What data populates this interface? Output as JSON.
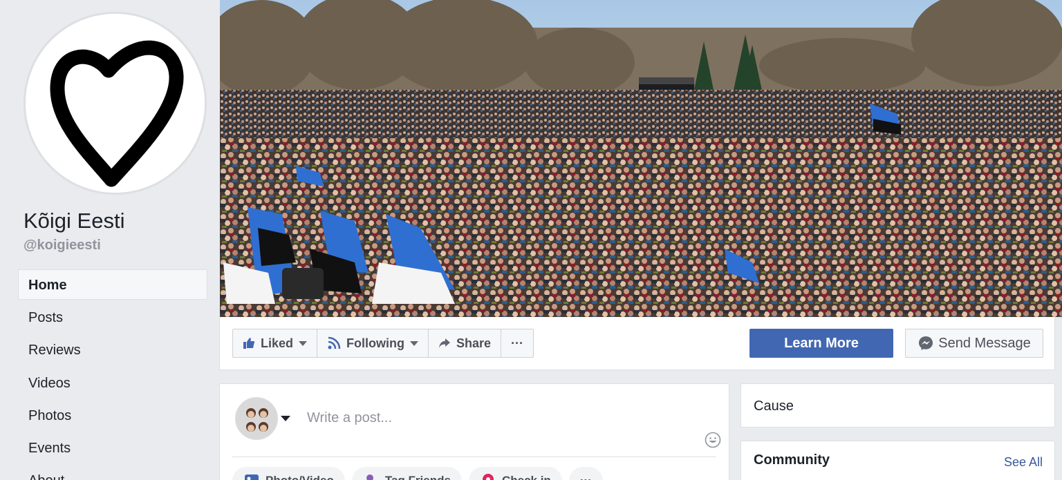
{
  "page": {
    "name": "Kõigi Eesti",
    "handle": "@koigieesti"
  },
  "nav": {
    "items": [
      {
        "label": "Home",
        "active": true
      },
      {
        "label": "Posts"
      },
      {
        "label": "Reviews"
      },
      {
        "label": "Videos"
      },
      {
        "label": "Photos"
      },
      {
        "label": "Events"
      },
      {
        "label": "About"
      }
    ]
  },
  "actions": {
    "liked": "Liked",
    "following": "Following",
    "share": "Share",
    "more": "···",
    "learn_more": "Learn More",
    "send_message": "Send Message"
  },
  "composer": {
    "placeholder": "Write a post...",
    "buttons": [
      "Photo/Video",
      "Tag Friends",
      "Check in",
      "···"
    ]
  },
  "sidebar": {
    "cause": "Cause",
    "community_title": "Community",
    "see_all": "See All"
  },
  "colors": {
    "brand_blue": "#4267b2",
    "link_blue": "#365899",
    "background": "#e9ebee"
  },
  "icons": {
    "liked": "thumbs-up-icon",
    "following": "rss-icon",
    "share": "share-arrow-icon",
    "send_message": "messenger-icon",
    "emoji": "smiley-icon",
    "photo": "photo-icon",
    "tag": "tag-friends-icon",
    "checkin": "location-pin-icon"
  }
}
